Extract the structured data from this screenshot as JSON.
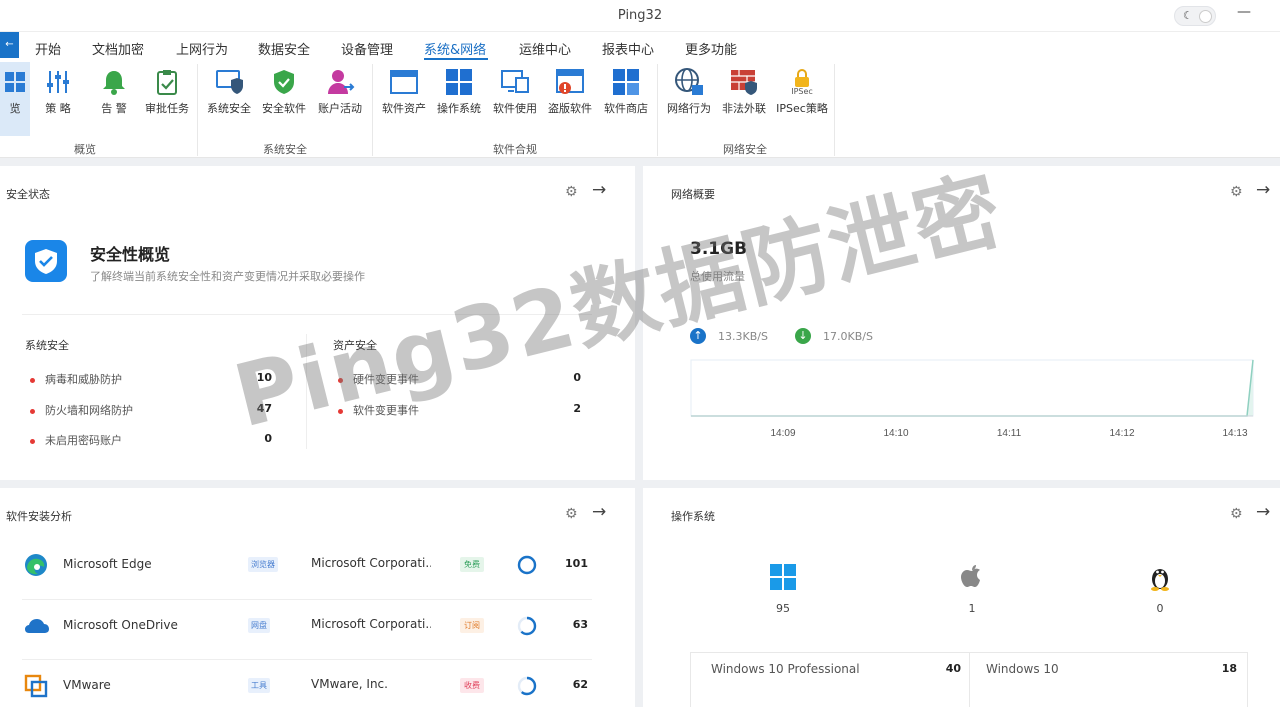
{
  "window": {
    "title": "Ping32"
  },
  "menu": {
    "home_label": "←",
    "items": [
      {
        "label": "开始"
      },
      {
        "label": "文档加密"
      },
      {
        "label": "上网行为"
      },
      {
        "label": "数据安全"
      },
      {
        "label": "设备管理"
      },
      {
        "label": "系统&网络",
        "active": true
      },
      {
        "label": "运维中心"
      },
      {
        "label": "报表中心"
      },
      {
        "label": "更多功能"
      }
    ]
  },
  "ribbon": {
    "groups": [
      {
        "label": "概览",
        "buttons": [
          {
            "label": "览",
            "icon": "overview-icon"
          },
          {
            "label": "策 略",
            "icon": "sliders-icon"
          },
          {
            "label": "告 警",
            "icon": "bell-icon"
          },
          {
            "label": "审批任务",
            "icon": "clipboard-check-icon"
          }
        ]
      },
      {
        "label": "系统安全",
        "buttons": [
          {
            "label": "系统安全",
            "icon": "shield-monitor-icon"
          },
          {
            "label": "安全软件",
            "icon": "shield-check-icon"
          },
          {
            "label": "账户活动",
            "icon": "user-activity-icon"
          }
        ]
      },
      {
        "label": "软件合规",
        "buttons": [
          {
            "label": "软件资产",
            "icon": "window-icon"
          },
          {
            "label": "操作系统",
            "icon": "windows-logo-icon"
          },
          {
            "label": "软件使用",
            "icon": "monitor-icon"
          },
          {
            "label": "盗版软件",
            "icon": "window-alert-icon"
          },
          {
            "label": "软件商店",
            "icon": "store-icon"
          }
        ]
      },
      {
        "label": "网络安全",
        "buttons": [
          {
            "label": "网络行为",
            "icon": "globe-icon"
          },
          {
            "label": "非法外联",
            "icon": "firewall-icon"
          },
          {
            "label": "IPSec策略",
            "icon": "lock-icon",
            "badge": "IPSec"
          }
        ]
      }
    ]
  },
  "security_card": {
    "title": "安全状态",
    "headline": "安全性概览",
    "description": "了解终端当前系统安全性和资产变更情况并采取必要操作",
    "system_section": {
      "title": "系统安全",
      "rows": [
        {
          "label": "病毒和威胁防护",
          "value": "10"
        },
        {
          "label": "防火墙和网络防护",
          "value": "47"
        },
        {
          "label": "未启用密码账户",
          "value": "0"
        }
      ]
    },
    "asset_section": {
      "title": "资产安全",
      "rows": [
        {
          "label": "硬件变更事件",
          "value": "0"
        },
        {
          "label": "软件变更事件",
          "value": "2"
        }
      ]
    }
  },
  "network_card": {
    "title": "网络概要",
    "total": "3.1GB",
    "total_label": "总使用流量",
    "upload": "13.3KB/S",
    "download": "17.0KB/S"
  },
  "chart_data": {
    "type": "area",
    "title": "",
    "x": [
      "14:09",
      "14:10",
      "14:11",
      "14:12",
      "14:13"
    ],
    "xlabel": "",
    "ylabel": "",
    "grid": false,
    "series": [
      {
        "values": [
          0,
          0,
          0,
          0,
          1
        ]
      }
    ],
    "colors": {
      "line": "#8fd0c0",
      "fill": "#e3f4ef",
      "axis": "#cfd6de"
    }
  },
  "software_card": {
    "title": "软件安装分析",
    "rows": [
      {
        "name": "Microsoft Edge",
        "category": "浏览器",
        "vendor": "Microsoft Corporati...",
        "license": "免费",
        "license_color": "#2e9e5b",
        "license_bg": "#e5f5ea",
        "count": "101",
        "ring": 1.0,
        "icon": "edge-icon"
      },
      {
        "name": "Microsoft OneDrive",
        "category": "网盘",
        "vendor": "Microsoft Corporati...",
        "license": "订阅",
        "license_color": "#e07b2a",
        "license_bg": "#fdf0e4",
        "count": "63",
        "ring": 0.62,
        "icon": "onedrive-icon"
      },
      {
        "name": "VMware",
        "category": "工具",
        "vendor": "VMware, Inc.",
        "license": "收费",
        "license_color": "#e0405a",
        "license_bg": "#fde6ea",
        "count": "62",
        "ring": 0.61,
        "icon": "vmware-icon"
      }
    ]
  },
  "os_card": {
    "title": "操作系统",
    "platforms": [
      {
        "name": "windows-logo-icon",
        "count": "95"
      },
      {
        "name": "apple-logo-icon",
        "count": "1"
      },
      {
        "name": "linux-logo-icon",
        "count": "0"
      }
    ],
    "versions": [
      {
        "label": "Windows 10 Professional",
        "value": "40"
      },
      {
        "label": "Windows 10",
        "value": "18"
      }
    ]
  },
  "watermark": "Ping32数据防泄密",
  "colors": {
    "accent": "#1a73c8",
    "danger": "#e53935"
  }
}
